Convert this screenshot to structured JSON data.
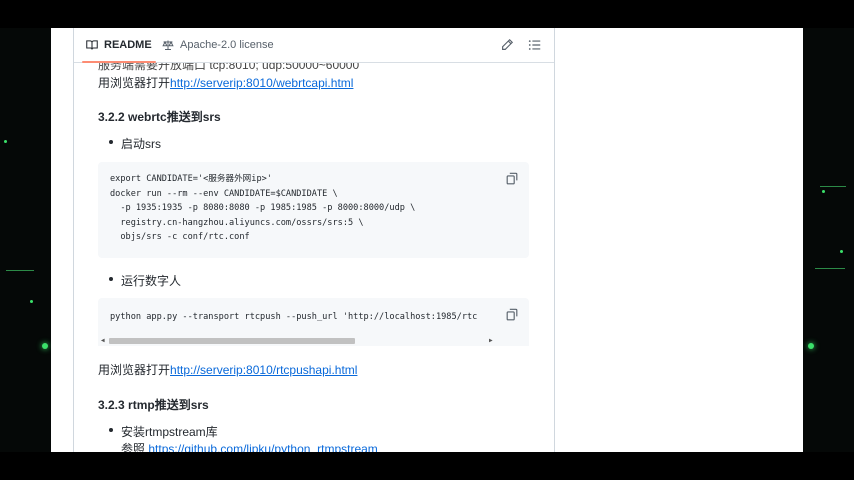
{
  "tabs": {
    "readme": "README",
    "license": "Apache-2.0 license"
  },
  "top_partial": "服务端需要开放端口 tcp:8010; udp:50000~60000",
  "open_prefix": "用浏览器打开",
  "webrtc_url": "http://serverip:8010/webrtcapi.html",
  "section_webrtc": "3.2.2 webrtc推送到srs",
  "bullet_start_srs": "启动srs",
  "code_srs": "export CANDIDATE='<服务器外网ip>'\ndocker run --rm --env CANDIDATE=$CANDIDATE \\\n  -p 1935:1935 -p 8080:8080 -p 1985:1985 -p 8000:8000/udp \\\n  registry.cn-hangzhou.aliyuncs.com/ossrs/srs:5 \\\n  objs/srs -c conf/rtc.conf",
  "bullet_run": "运行数字人",
  "code_run": "python app.py --transport rtcpush --push_url 'http://localhost:1985/rtc",
  "rtcpush_url": "http://serverip:8010/rtcpushapi.html",
  "section_rtmp": "3.2.3 rtmp推送到srs",
  "bullet_install": "安装rtmpstream库",
  "ref_prefix": "参照",
  "ref_url": "https://github.com/lipku/python_rtmpstream",
  "colors": {
    "link": "#0969da",
    "code_bg": "#f6f8fa",
    "tab_underline": "#fd8c73",
    "backdrop": "#050807",
    "accent_green": "#3be06a"
  },
  "icons": [
    "book-icon",
    "scale-icon",
    "pencil-icon",
    "list-icon",
    "copy-icon"
  ]
}
